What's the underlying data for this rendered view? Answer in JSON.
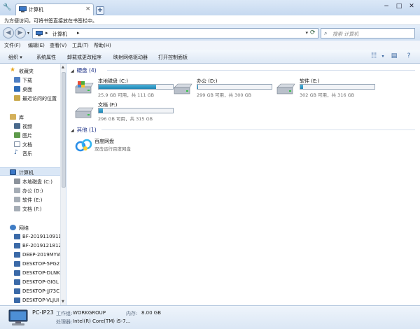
{
  "tab": {
    "title": "计算机"
  },
  "notice": "为方便访问，可将书签直接放在书签栏中。",
  "address": {
    "crumb": "计算机",
    "search_placeholder": "搜索 计算机"
  },
  "menu": [
    "文件(F)",
    "编辑(E)",
    "查看(V)",
    "工具(T)",
    "帮助(H)"
  ],
  "toolbar": [
    "组织 ▾",
    "系统属性",
    "卸载或更改程序",
    "映射网络驱动器",
    "打开控制面板"
  ],
  "nav": {
    "favorites_header": "收藏夹",
    "favorites": [
      "下载",
      "桌面",
      "最近访问的位置"
    ],
    "library_header": "库",
    "library": [
      "视频",
      "图片",
      "文档",
      "音乐"
    ],
    "computer_header": "计算机",
    "drives": [
      "本地磁盘 (C:)",
      "办公 (D:)",
      "软件 (E:)",
      "文档 (F:)"
    ],
    "network_header": "网络",
    "network": [
      "BF-2019110911",
      "BF-2019121812",
      "DEEP-2019MYW",
      "DESKTOP-5PG2",
      "DESKTOP-DLNK",
      "DESKTOP-GIGL",
      "DESKTOP-JJ73C",
      "DESKTOP-VLJUI"
    ]
  },
  "groups": {
    "disks": "硬盘 (4)",
    "other": "其他 (1)"
  },
  "drives": [
    {
      "name": "本地磁盘 (C:)",
      "info": "25.9 GB 可用，共 111 GB",
      "used": 0.77
    },
    {
      "name": "办公 (D:)",
      "info": "299 GB 可用，共 300 GB",
      "used": 0.01
    },
    {
      "name": "软件 (E:)",
      "info": "302 GB 可用，共 316 GB",
      "used": 0.04
    },
    {
      "name": "文档 (F:)",
      "info": "296 GB 可用，共 315 GB",
      "used": 0.06
    }
  ],
  "other_item": {
    "name": "百度网盘",
    "desc": "双击运行百度网盘"
  },
  "details": {
    "pc_name": "PC-IP23",
    "workgroup_label": "工作组:",
    "workgroup": "WORKGROUP",
    "memory_label": "内存:",
    "memory": "8.00 GB",
    "cpu_label": "处理器:",
    "cpu": "Intel(R) Core(TM) i5-7..."
  },
  "colors": {
    "accent": "#1e3287",
    "bar_fill": "#2a94c2",
    "selection": "#dae7f6"
  }
}
